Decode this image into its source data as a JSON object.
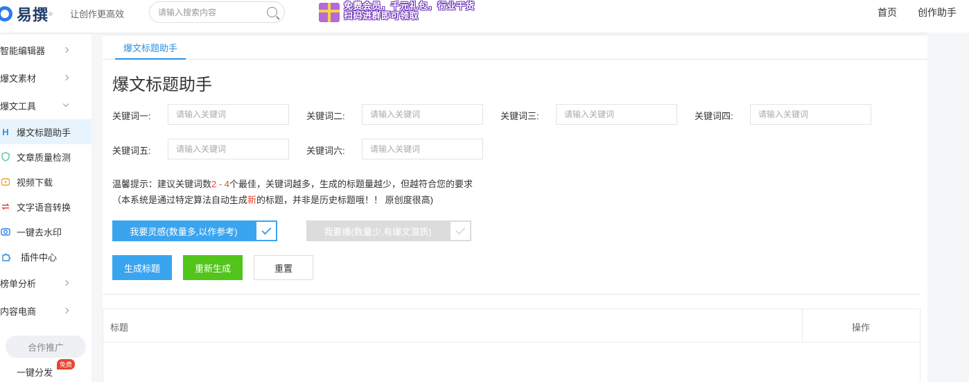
{
  "header": {
    "logo_text": "易撰",
    "logo_mark": "®",
    "slogan": "让创作更高效",
    "search_placeholder": "请输入搜索内容",
    "promo_line1": "免费会员，千元礼包，行业干货",
    "promo_line2": "扫码进群即可领取",
    "nav": [
      "首页",
      "创作助手"
    ]
  },
  "sidebar": {
    "groups": [
      {
        "label": "智能编辑器"
      },
      {
        "label": "爆文素材"
      },
      {
        "label": "爆文工具"
      }
    ],
    "tools": [
      {
        "label": "爆文标题助手",
        "icon": "H",
        "color": "#2b90e0"
      },
      {
        "label": "文章质量检测",
        "icon": "shield",
        "color": "#52c4a0"
      },
      {
        "label": "视频下载",
        "icon": "video",
        "color": "#f0a030"
      },
      {
        "label": "文字语音转换",
        "icon": "convert",
        "color": "#e8452c"
      },
      {
        "label": "一键去水印",
        "icon": "camera",
        "color": "#2b7de9"
      },
      {
        "label": "插件中心",
        "icon": "puzzle",
        "color": "#2b90e0"
      }
    ],
    "groups2": [
      {
        "label": "榜单分析"
      },
      {
        "label": "内容电商"
      }
    ],
    "coop_label": "合作推广",
    "distribute_label": "一键分发",
    "free_badge": "免费"
  },
  "main": {
    "tab": "爆文标题助手",
    "title": "爆文标题助手",
    "keywords": [
      {
        "label": "关键词一:",
        "placeholder": "请输入关键词"
      },
      {
        "label": "关键词二:",
        "placeholder": "请输入关键词"
      },
      {
        "label": "关键词三:",
        "placeholder": "请输入关键词"
      },
      {
        "label": "关键词四:",
        "placeholder": "请输入关键词"
      },
      {
        "label": "关键词五:",
        "placeholder": "请输入关键词"
      },
      {
        "label": "关键词六:",
        "placeholder": "请输入关键词"
      }
    ],
    "tip_prefix": "温馨提示：建议关键词数",
    "tip_range": "2 - 4",
    "tip_suffix": "个最佳，关键词越多，生成的标题量越少，但越符合您的要求",
    "tip2_prefix": "（本系统是通过特定算法自动生成",
    "tip2_hl": "新",
    "tip2_suffix": "的标题，并非是历史标题哦！！ 原创度很高)",
    "mode_inspire": "我要灵感(数量多,以作参考)",
    "mode_hot": "我要爆(数量少,有爆文潜质)",
    "btn_generate": "生成标题",
    "btn_regenerate": "重新生成",
    "btn_reset": "重置",
    "table_col_title": "标题",
    "table_col_op": "操作"
  }
}
